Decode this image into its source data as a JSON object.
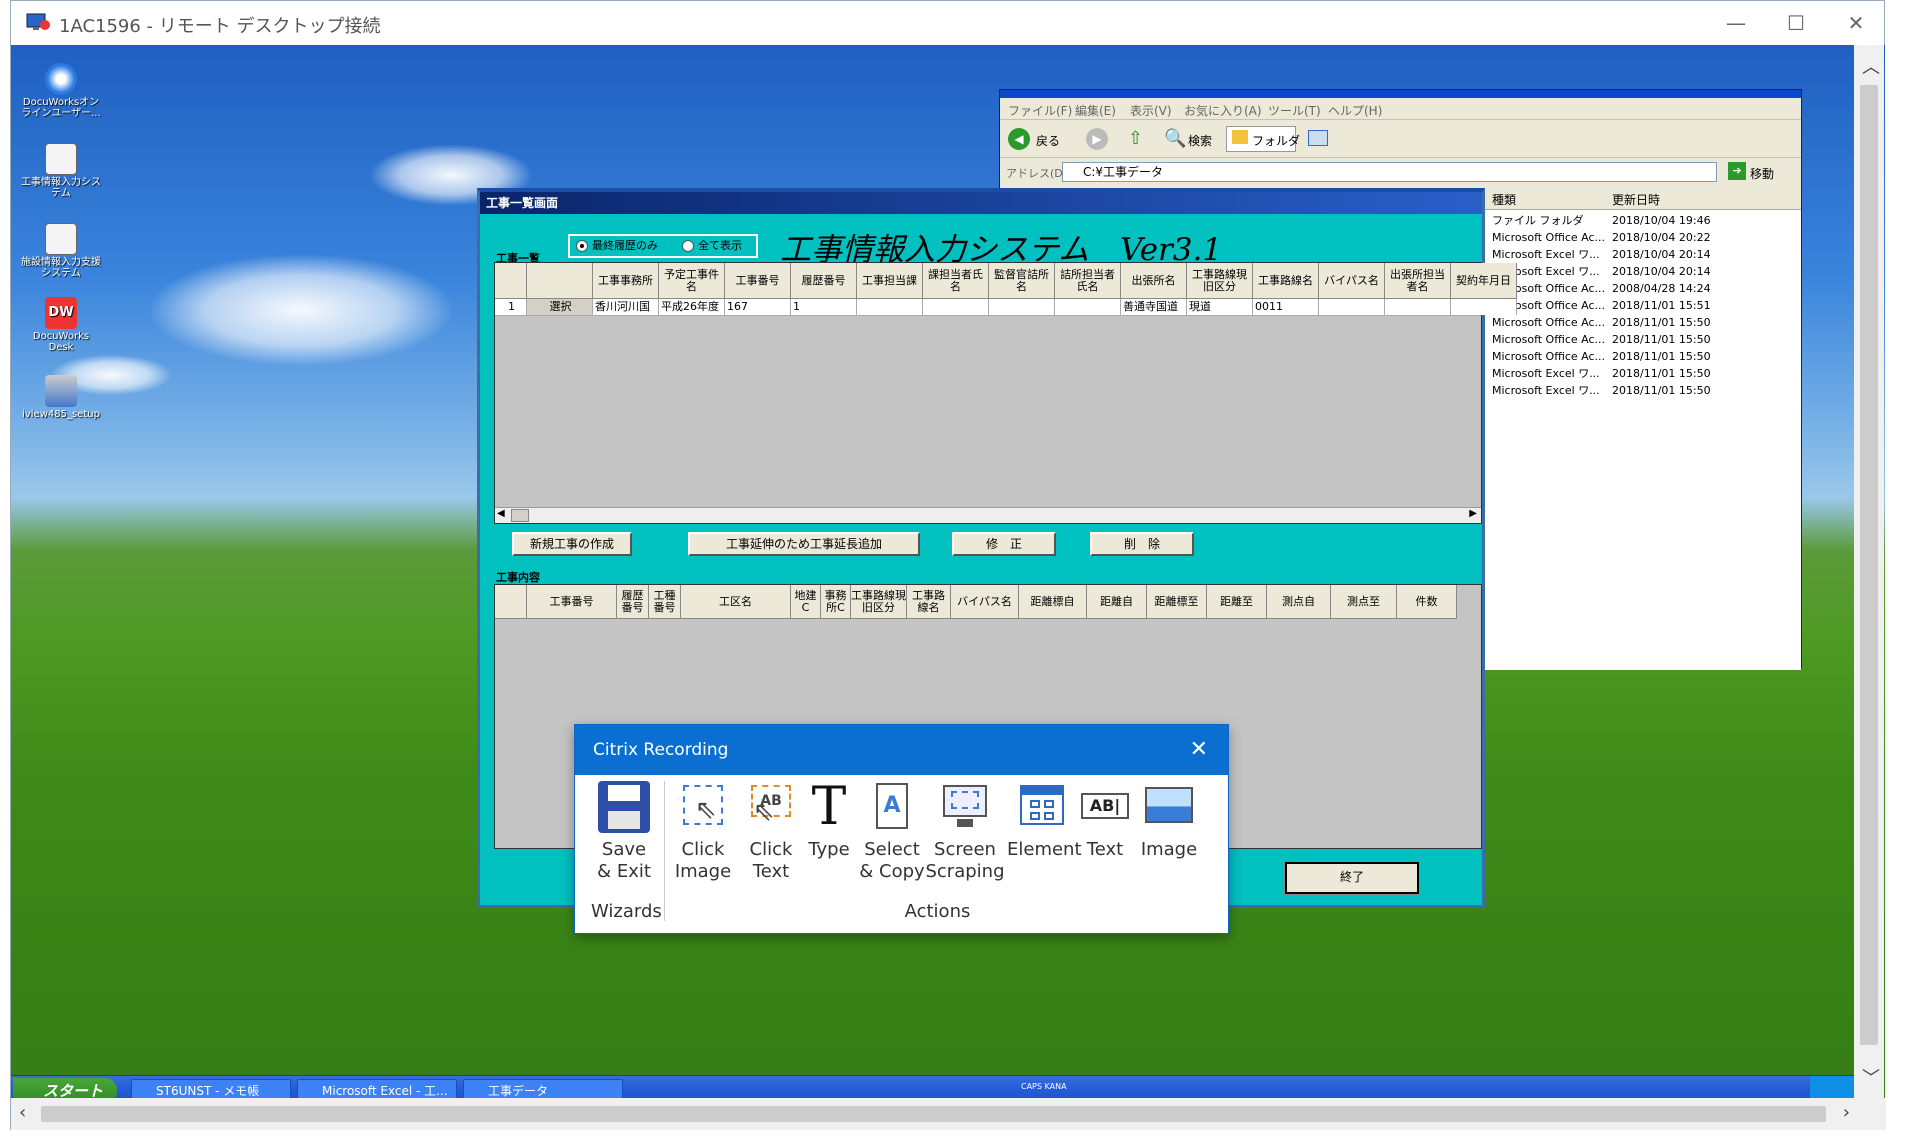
{
  "rdp": {
    "title": "1AC1596 - リモート デスクトップ接続"
  },
  "desktop_icons": [
    {
      "label": "DocuWorksオンラインユーザー..."
    },
    {
      "label": "工事情報入力システム"
    },
    {
      "label": "施設情報入力支援システム"
    },
    {
      "label": "DocuWorks Desk"
    },
    {
      "label": "iview485_setup"
    }
  ],
  "explorer": {
    "title": "工事データ",
    "menu": [
      "ファイル(F)",
      "編集(E)",
      "表示(V)",
      "お気に入り(A)",
      "ツール(T)",
      "ヘルプ(H)"
    ],
    "back": "戻る",
    "search": "検索",
    "folder": "フォルダ",
    "address_label": "アドレス(D)",
    "address_value": "C:¥工事データ",
    "go": "移動",
    "col_type": "種類",
    "col_date": "更新日時",
    "rows": [
      {
        "type": "ファイル フォルダ",
        "date": "2018/10/04 19:46"
      },
      {
        "type": "Microsoft Office Ac...",
        "date": "2018/10/04 20:22"
      },
      {
        "type": "Microsoft Excel ワ...",
        "date": "2018/10/04 20:14"
      },
      {
        "type": "Microsoft Excel ワ...",
        "date": "2018/10/04 20:14"
      },
      {
        "type": "Microsoft Office Ac...",
        "date": "2008/04/28 14:24"
      },
      {
        "type": "Microsoft Office Ac...",
        "date": "2018/11/01 15:51"
      },
      {
        "type": "Microsoft Office Ac...",
        "date": "2018/11/01 15:50"
      },
      {
        "type": "Microsoft Office Ac...",
        "date": "2018/11/01 15:50"
      },
      {
        "type": "Microsoft Office Ac...",
        "date": "2018/11/01 15:50"
      },
      {
        "type": "Microsoft Excel ワ...",
        "date": "2018/11/01 15:50"
      },
      {
        "type": "Microsoft Excel ワ...",
        "date": "2018/11/01 15:50"
      }
    ]
  },
  "kouji": {
    "title": "工事一覧画面",
    "list_label": "工事一覧",
    "radio1": "最終履歴のみ",
    "radio2": "全て表示",
    "heading": "工事情報入力システム　Ver3.1",
    "headers": [
      "工事事務所",
      "予定工事件名",
      "工事番号",
      "履歴番号",
      "工事担当課",
      "課担当者氏名",
      "監督官詰所名",
      "詰所担当者氏名",
      "出張所名",
      "工事路線現旧区分",
      "工事路線名",
      "バイパス名",
      "出張所担当者名",
      "契約年月日"
    ],
    "row": {
      "num": "1",
      "select": "選択",
      "cells": [
        "香川河川国",
        "平成26年度",
        "167",
        "1",
        "",
        "",
        "",
        "",
        "善通寺国道",
        "現道",
        "0011",
        "",
        "",
        ""
      ]
    },
    "btn_new": "新規工事の作成",
    "btn_extend": "工事延伸のため工事延長追加",
    "btn_edit": "修　正",
    "btn_delete": "削　除",
    "content_label": "工事内容",
    "content_headers": [
      "工事番号",
      "履歴番号",
      "工種番号",
      "工区名",
      "地建C",
      "事務所C",
      "工事路線現旧区分",
      "工事路線名",
      "バイパス名",
      "距離標自",
      "距離自",
      "距離標至",
      "距離至",
      "測点自",
      "測点至",
      "件数"
    ],
    "btn_exit": "終了"
  },
  "citrix": {
    "title": "Citrix Recording",
    "save": "Save & Exit",
    "wizards": "Wizards",
    "actions": "Actions",
    "items": [
      {
        "label": "Click Image",
        "icon": "click-image-icon"
      },
      {
        "label": "Click Text",
        "icon": "click-text-icon"
      },
      {
        "label": "Type",
        "icon": "type-icon"
      },
      {
        "label": "Select & Copy",
        "icon": "select-copy-icon"
      },
      {
        "label": "Screen Scraping",
        "icon": "screen-scraping-icon"
      },
      {
        "label": "Element",
        "icon": "element-icon"
      },
      {
        "label": "Text",
        "icon": "text-icon"
      },
      {
        "label": "Image",
        "icon": "image-icon"
      }
    ]
  },
  "taskbar": {
    "start": "スタート",
    "items": [
      "ST6UNST - メモ帳",
      "Microsoft Excel - 工...",
      "工事データ"
    ],
    "tray": "CAPS KANA"
  }
}
